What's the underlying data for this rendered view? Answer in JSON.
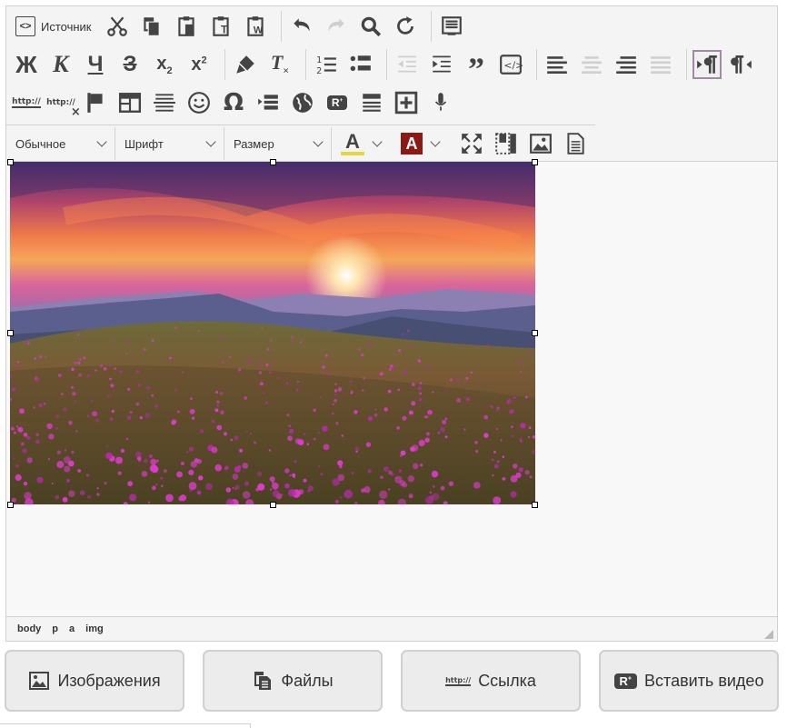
{
  "toolbar": {
    "source_label": "Источник",
    "format_select": "Обычное",
    "font_select": "Шрифт",
    "size_select": "Размер",
    "text_color_letter": "A",
    "bg_color_letter": "A",
    "link_text": "http://",
    "unlink_text": "http://"
  },
  "path": [
    "body",
    "p",
    "a",
    "img"
  ],
  "buttons": {
    "images": "Изображения",
    "files": "Файлы",
    "link": "Ссылка",
    "link_icon_text": "http://",
    "video": "Вставить видео"
  },
  "colors": {
    "text_color_bar": "#e7d53a",
    "bg_color_box": "#8b1a14",
    "active_border": "#a08aa6"
  }
}
